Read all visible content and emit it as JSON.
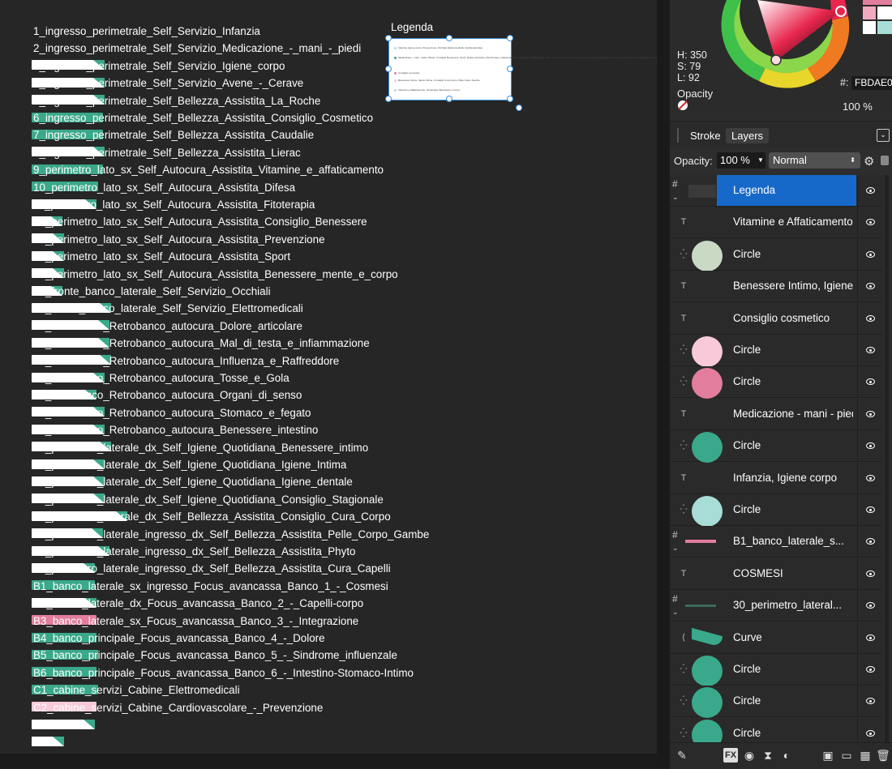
{
  "canvas": {
    "artboards": [
      {
        "label": "1_ingresso_perimetrale_Self_Servizio_Infanzia",
        "swatch": "none"
      },
      {
        "label": "2_ingresso_perimetrale_Self_Servizio_Medicazione_-_mani_-_piedi",
        "swatch": "white"
      },
      {
        "label": "3_ingresso_perimetrale_Self_Servizio_Igiene_corpo",
        "swatch": "white"
      },
      {
        "label": "4_ingresso_perimetrale_Self_Servizio_Avene_-_Cerave",
        "swatch": "white"
      },
      {
        "label": "5_ingresso_perimetrale_Self_Bellezza_Assistita_La_Roche",
        "swatch": "green"
      },
      {
        "label": "6_ingresso_perimetrale_Self_Bellezza_Assistita_Consiglio_Cosmetico",
        "swatch": "green"
      },
      {
        "label": "7_ingresso_perimetrale_Self_Bellezza_Assistita_Caudalie",
        "swatch": "white"
      },
      {
        "label": "8_ingresso_perimetrale_Self_Bellezza_Assistita_Lierac",
        "swatch": "green"
      },
      {
        "label": "9_perimetro_lato_sx_Self_Autocura_Assistita_Vitamine_e_affaticamento",
        "swatch": "green"
      },
      {
        "label": "10_perimetro_lato_sx_Self_Autocura_Assistita_Difesa",
        "swatch": "white"
      },
      {
        "label": "11_perimetro_lato_sx_Self_Autocura_Assistita_Fitoterapia",
        "swatch": "white"
      },
      {
        "label": "12_perimetro_lato_sx_Self_Autocura_Assistita_Consiglio_Benessere",
        "swatch": "white"
      },
      {
        "label": "13_perimetro_lato_sx_Self_Autocura_Assistita_Prevenzione",
        "swatch": "white"
      },
      {
        "label": "14_perimetro_lato_sx_Self_Autocura_Assistita_Sport",
        "swatch": "white"
      },
      {
        "label": "15_perimetro_lato_sx_Self_Autocura_Assistita_Benessere_mente_e_corpo",
        "swatch": "white"
      },
      {
        "label": "16_fronte_banco_laterale_Self_Servizio_Occhiali",
        "swatch": "white"
      },
      {
        "label": "17_fronte_banco_laterale_Self_Servizio_Elettromedicali",
        "swatch": "white"
      },
      {
        "label": "18_retrobanco_Retrobanco_autocura_Dolore_articolare",
        "swatch": "white"
      },
      {
        "label": "19_retrobanco_Retrobanco_autocura_Mal_di_testa_e_infiammazione",
        "swatch": "white"
      },
      {
        "label": "20_retrobanco_Retrobanco_autocura_Influenza_e_Raffreddore",
        "swatch": "white"
      },
      {
        "label": "21_retrobanco_Retrobanco_autocura_Tosse_e_Gola",
        "swatch": "white"
      },
      {
        "label": "22_retrobanco_Retrobanco_autocura_Organi_di_senso",
        "swatch": "white"
      },
      {
        "label": "23_retrobanco_Retrobanco_autocura_Stomaco_e_fegato",
        "swatch": "white"
      },
      {
        "label": "24_retrobanco_Retrobanco_autocura_Benessere_intestino",
        "swatch": "white"
      },
      {
        "label": "25_perimetro_laterale_dx_Self_Igiene_Quotidiana_Benessere_intimo",
        "swatch": "white"
      },
      {
        "label": "26_perimetro_laterale_dx_Self_Igiene_Quotidiana_Igiene_Intima",
        "swatch": "white"
      },
      {
        "label": "27_perimetro_laterale_dx_Self_Igiene_Quotidiana_Igiene_dentale",
        "swatch": "white"
      },
      {
        "label": "28_perimetro_laterale_dx_Self_Igiene_Quotidiana_Consiglio_Stagionale",
        "swatch": "white"
      },
      {
        "label": "29_perimetro_laterale_dx_Self_Bellezza_Assistita_Consiglio_Cura_Corpo",
        "swatch": "white"
      },
      {
        "label": "30_perimetro_laterale_ingresso_dx_Self_Bellezza_Assistita_Pelle_Corpo_Gambe",
        "swatch": "white"
      },
      {
        "label": "31_perimetro_laterale_ingresso_dx_Self_Bellezza_Assistita_Phyto",
        "swatch": "white"
      },
      {
        "label": "30_perimetro_laterale_ingresso_dx_Self_Bellezza_Assistita_Cura_Capelli",
        "swatch": "green"
      },
      {
        "label": "B1_banco_laterale_sx_ingresso_Focus_avancassa_Banco_1_-_Cosmesi",
        "swatch": "white"
      },
      {
        "label": "B2_banco_laterale_dx_Focus_avancassa_Banco_2_-_Capelli-corpo",
        "swatch": "pink"
      },
      {
        "label": "B3_banco_laterale_sx_Focus_avancassa_Banco_3_-_Integrazione",
        "swatch": "green"
      },
      {
        "label": "B4_banco_principale_Focus_avancassa_Banco_4_-_Dolore",
        "swatch": "green"
      },
      {
        "label": "B5_banco_principale_Focus_avancassa_Banco_5_-_Sindrome_influenzale",
        "swatch": "green"
      },
      {
        "label": "B6_banco_principale_Focus_avancassa_Banco_6_-_Intestino-Stomaco-Intimo",
        "swatch": "green"
      },
      {
        "label": "C1_cabine_servizi_Cabine_Elettromedicali",
        "swatch": "pinklight"
      },
      {
        "label": "C2_cabine_servizi_Cabine_Cardiovascolare_-_Prevenzione",
        "swatch": "white"
      },
      {
        "label": "",
        "swatch": "white"
      }
    ],
    "legend_title": "Legenda",
    "legend_rows": [
      {
        "color": "#a7ddd6",
        "text": "Infanzia, Igiene corpo, Prevenzione, Occhiali, Elettromedicali, Cardiovascolare"
      },
      {
        "color": "#3aa88a",
        "text": "Medicazione - mani - piedi, Difesa, Consiglio Benessere, Sport, Dolore articolare, Mal di testa e infiammazione, Influenza e Raffreddore, Tosse e Gola, Organi di senso, Stomaco e fegato, Benessere intestino, Igiene dentale, Consiglio Stagionale"
      },
      {
        "color": "#e37d9d",
        "text": "Consiglio cosmetico"
      },
      {
        "color": "#f7c9d9",
        "text": "Benessere Intimo, Igiene Intima, Consiglio Cura Corpo, Pelle Corpo Gambe"
      },
      {
        "color": "#c9d9c4",
        "text": "Vitamine e Affaticamento, Fitoterapia, Benessere e Corpo"
      }
    ]
  },
  "color_panel": {
    "h": "H: 350",
    "s": "S: 79",
    "l": "L: 92",
    "hex_label": "#:",
    "hex_value": "FBDAE0",
    "opacity_label": "Opacity",
    "opacity_value": "100 %"
  },
  "tabs": {
    "stroke": "Stroke",
    "layers": "Layers"
  },
  "layer_controls": {
    "opacity_label": "Opacity:",
    "opacity_value": "100 %",
    "blend_mode": "Normal"
  },
  "layers": [
    {
      "name": "Legenda",
      "kind": "group",
      "selected": true,
      "thumb": "legend"
    },
    {
      "name": "Vitamine e Affaticamento",
      "kind": "text",
      "thumb": "none"
    },
    {
      "name": "Circle",
      "kind": "shape",
      "thumb": "#c9d9c4"
    },
    {
      "name": "Benessere Intimo, Igiene Intima",
      "kind": "text",
      "thumb": "none"
    },
    {
      "name": "Consiglio cosmetico",
      "kind": "text",
      "thumb": "none"
    },
    {
      "name": "Circle",
      "kind": "shape",
      "thumb": "#f7c9d9"
    },
    {
      "name": "Circle",
      "kind": "shape",
      "thumb": "#e37d9d"
    },
    {
      "name": "Medicazione - mani - piedi",
      "kind": "text",
      "thumb": "none"
    },
    {
      "name": "Circle",
      "kind": "shape",
      "thumb": "#3aa88a"
    },
    {
      "name": "Infanzia, Igiene corpo",
      "kind": "text",
      "thumb": "none"
    },
    {
      "name": "Circle",
      "kind": "shape",
      "thumb": "#a7ddd6"
    },
    {
      "name": "B1_banco_laterale_s...",
      "kind": "group",
      "thumb": "pinkbar"
    },
    {
      "name": "COSMESI",
      "kind": "text",
      "thumb": "none"
    },
    {
      "name": "30_perimetro_lateral...",
      "kind": "group",
      "thumb": "greenbar"
    },
    {
      "name": "Curve",
      "kind": "curve",
      "thumb": "curve"
    },
    {
      "name": "Circle",
      "kind": "shape",
      "thumb": "#3aa88a"
    },
    {
      "name": "Circle",
      "kind": "shape",
      "thumb": "#3aa88a"
    },
    {
      "name": "Circle",
      "kind": "shape",
      "thumb": "#3aa88a"
    }
  ],
  "colors": {
    "accent": "#1769c9",
    "green": "#3aa88a",
    "pink": "#e37d9d",
    "pink_light": "#f7c9d9",
    "teal_light": "#a7ddd6",
    "sage": "#c9d9c4"
  }
}
